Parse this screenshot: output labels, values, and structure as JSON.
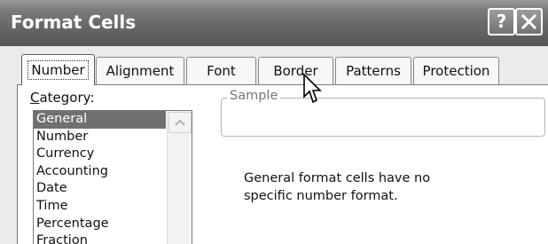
{
  "window": {
    "title": "Format Cells",
    "help_label": "?",
    "close_icon": "close-icon"
  },
  "tabs": [
    {
      "label": "Number",
      "active": true
    },
    {
      "label": "Alignment",
      "active": false
    },
    {
      "label": "Font",
      "active": false
    },
    {
      "label": "Border",
      "active": false
    },
    {
      "label": "Patterns",
      "active": false
    },
    {
      "label": "Protection",
      "active": false
    }
  ],
  "category": {
    "label_accel": "C",
    "label_rest": "ategory:",
    "items": [
      "General",
      "Number",
      "Currency",
      "Accounting",
      "Date",
      "Time",
      "Percentage",
      "Fraction"
    ],
    "selected": "General"
  },
  "sample": {
    "label": "Sample"
  },
  "description": {
    "line1": "General format cells have no",
    "line2": "specific number format."
  },
  "colors": {
    "titlebar": "#6b6b6b",
    "selection": "#707070",
    "dialog_bg": "#ebebeb"
  }
}
